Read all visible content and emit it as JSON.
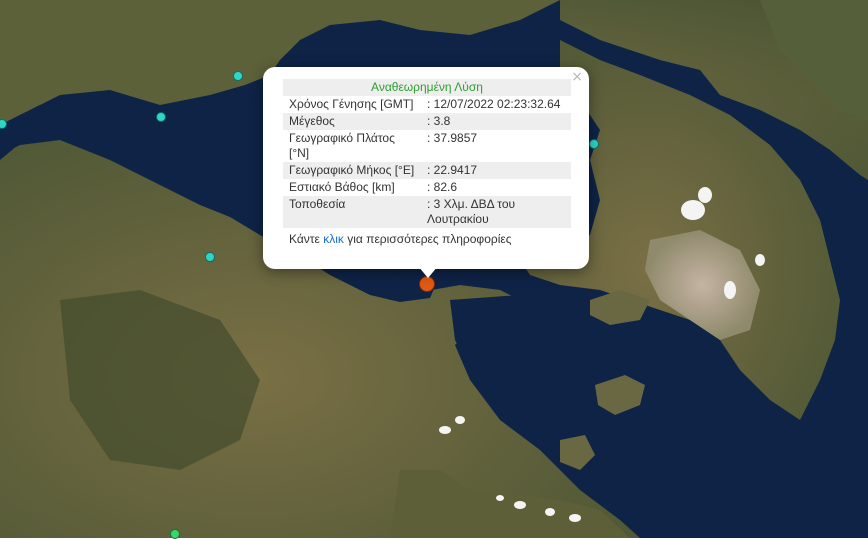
{
  "popup": {
    "title": "Αναθεωρημένη Λύση",
    "close_symbol": "×",
    "rows": [
      {
        "label": "Χρόνος Γένησης [GMT]",
        "value": ": 12/07/2022 02:23:32.64"
      },
      {
        "label": "Μέγεθος",
        "value": ": 3.8"
      },
      {
        "label": "Γεωγραφικό Πλάτος [°N]",
        "value": ": 37.9857"
      },
      {
        "label": "Γεωγραφικό Μήκος [°E]",
        "value": ": 22.9417"
      },
      {
        "label": "Εστιακό Βάθος [km]",
        "value": ": 82.6"
      },
      {
        "label": "Τοποθεσία",
        "value": ": 3 Χλμ. ΔΒΔ του Λουτρακίου"
      }
    ],
    "more_prefix": "Κάντε ",
    "more_link": "κλικ",
    "more_suffix": " για περισσότερες πληροφορίες"
  },
  "colors": {
    "land": "#6b6a3f",
    "land_dark": "#4a5132",
    "sea": "#0e2346",
    "urban": "#b09a86",
    "cloud": "#f4f4f4",
    "station": "#2fd6c8",
    "station_green": "#3bd36a",
    "epicenter": "#e05a12",
    "title_green": "#2e9e2e",
    "link_blue": "#1a6fbf"
  }
}
